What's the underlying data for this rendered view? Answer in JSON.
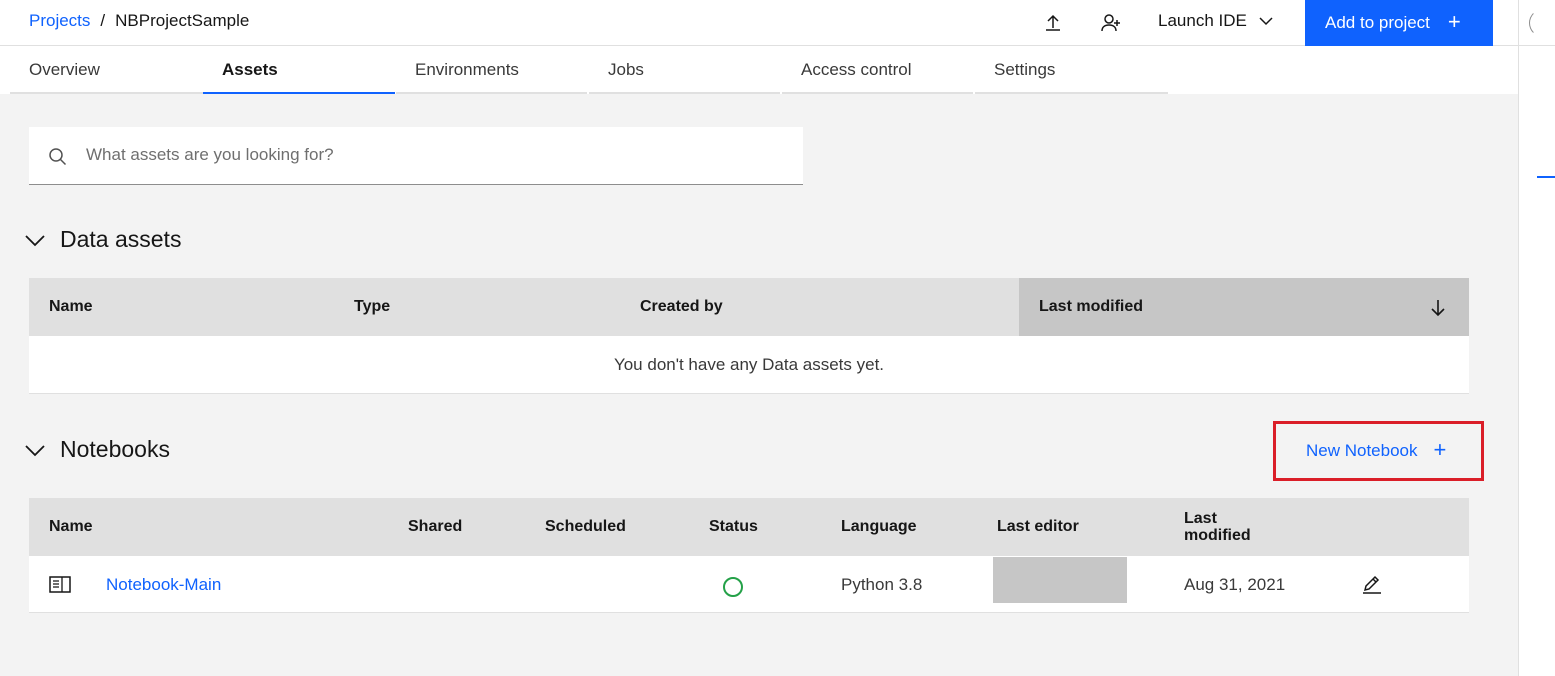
{
  "header": {
    "breadcrumb": {
      "root": "Projects",
      "separator": "/",
      "current": "NBProjectSample"
    },
    "upload_icon": "upload-icon",
    "add_collaborator_icon": "add-user-icon",
    "launch_ide_label": "Launch IDE",
    "add_to_project_label": "Add to project",
    "add_plus": "+"
  },
  "tabs": [
    {
      "label": "Overview"
    },
    {
      "label": "Assets"
    },
    {
      "label": "Environments"
    },
    {
      "label": "Jobs"
    },
    {
      "label": "Access control"
    },
    {
      "label": "Settings"
    }
  ],
  "active_tab": "Assets",
  "search": {
    "placeholder": "What assets are you looking for?",
    "value": ""
  },
  "data_assets": {
    "title": "Data assets",
    "columns": [
      "Name",
      "Type",
      "Created by",
      "Last modified"
    ],
    "sorted_column": "Last modified",
    "sort_direction": "descending",
    "empty_message": "You don't have any Data assets yet."
  },
  "notebooks": {
    "title": "Notebooks",
    "new_button_label": "New Notebook",
    "new_button_plus": "+",
    "columns": [
      "Name",
      "Shared",
      "Scheduled",
      "Status",
      "Language",
      "Last editor",
      "Last\nmodified"
    ],
    "rows": [
      {
        "icon": "notebook-icon",
        "name": "Notebook-Main",
        "shared": "",
        "scheduled": "",
        "status": "idle",
        "language": "Python 3.8",
        "last_editor": "",
        "last_modified": "Aug 31, 2021",
        "action_icon": "edit-icon"
      }
    ]
  },
  "colors": {
    "accent": "#0f62fe",
    "highlight_border": "#da1e28",
    "status_ok": "#24a148",
    "background": "#f3f3f3"
  }
}
